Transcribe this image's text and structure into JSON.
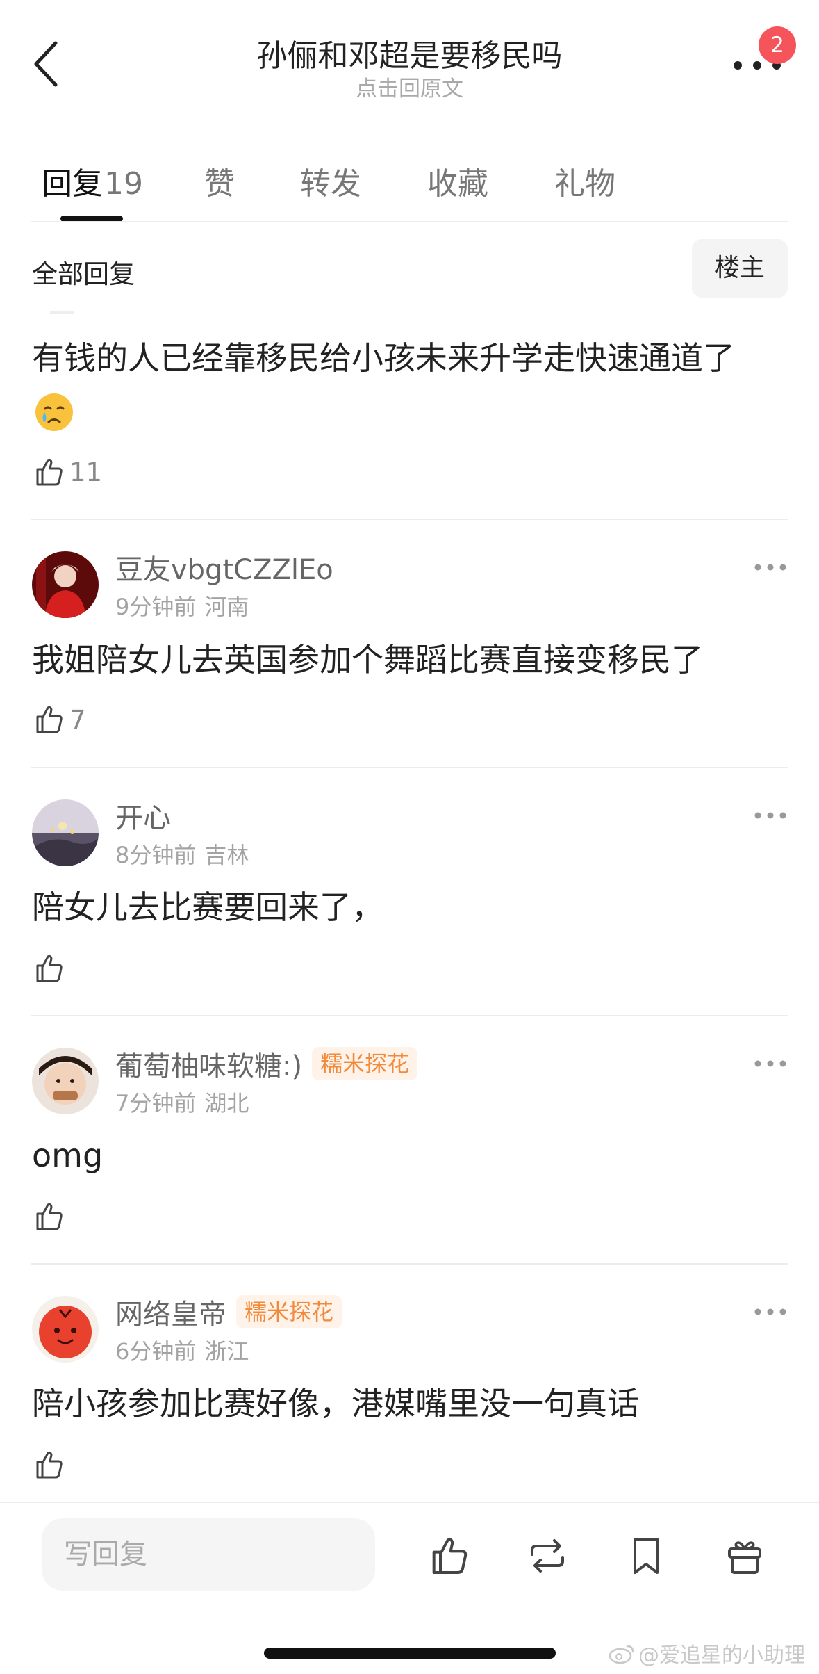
{
  "header": {
    "title": "孙俪和邓超是要移民吗",
    "subtitle": "点击回原文",
    "badge_count": "2"
  },
  "tabs": [
    {
      "label": "回复",
      "count": "19"
    },
    {
      "label": "赞"
    },
    {
      "label": "转发"
    },
    {
      "label": "收藏"
    },
    {
      "label": "礼物"
    }
  ],
  "filter": {
    "label": "全部回复",
    "owner_button": "楼主"
  },
  "comments": [
    {
      "text": "有钱的人已经靠移民给小孩未来升学走快速通道了",
      "emoji": "crying-face",
      "likes": "11"
    },
    {
      "username": "豆友vbgtCZZlEo",
      "time": "9分钟前",
      "region": "河南",
      "text": "我姐陪女儿去英国参加个舞蹈比赛直接变移民了",
      "likes": "7"
    },
    {
      "username": "开心",
      "time": "8分钟前",
      "region": "吉林",
      "text": "陪女儿去比赛要回来了，",
      "likes": ""
    },
    {
      "username": "葡萄柚味软糖:)",
      "tag": "糯米探花",
      "time": "7分钟前",
      "region": "湖北",
      "text": "omg",
      "likes": ""
    },
    {
      "username": "网络皇帝",
      "tag": "糯米探花",
      "time": "6分钟前",
      "region": "浙江",
      "text": "陪小孩参加比赛好像，港媒嘴里没一句真话",
      "likes": ""
    }
  ],
  "bottom_bar": {
    "reply_placeholder": "写回复"
  },
  "watermark": "@爱追星的小助理",
  "colors": {
    "badge": "#f4545a",
    "tag_bg": "#fff2e8",
    "tag_text": "#f28a3b",
    "muted_text": "#a3a3a3"
  }
}
